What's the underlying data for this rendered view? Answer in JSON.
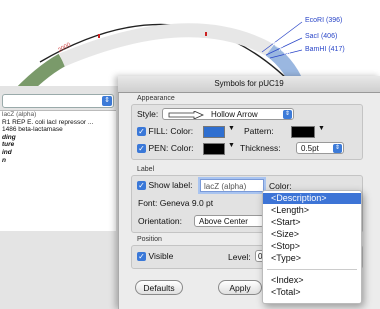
{
  "map": {
    "sites": [
      "EcoRI (396)",
      "SacI (406)",
      "BamHI (417)"
    ],
    "segment_labels": [
      "lacZ (alpha)",
      "2000"
    ]
  },
  "left": {
    "select_value": "",
    "features": [
      "lacZ (alpha)",
      "R1 REP E. coli lacI repressor ...",
      "1486 beta-lactamase",
      "ding",
      "ture",
      "ind",
      "n"
    ]
  },
  "dialog": {
    "title": "Symbols for pUC19",
    "appearance_label": "Appearance",
    "style_label": "Style:",
    "style_value": "Hollow Arrow",
    "fill_label": "FILL:",
    "fill_color_label": "Color:",
    "fill_color": "#2f6fd0",
    "pattern_label": "Pattern:",
    "pen_label": "PEN:",
    "pen_color_label": "Color:",
    "pen_color": "#000000",
    "thickness_label": "Thickness:",
    "thickness_value": "0.5pt",
    "label_group": "Label",
    "show_label": "Show label:",
    "label_value": "lacZ (alpha)",
    "color_label": "Color:",
    "font_text": "Font: Geneva 9.0 pt",
    "orientation_label": "Orientation:",
    "orientation_value": "Above Center",
    "position_group": "Position",
    "visible_label": "Visible",
    "level_label": "Level:",
    "level_value": "0",
    "defaults_button": "Defaults",
    "apply_button": "Apply"
  },
  "menu": {
    "items_top": [
      "<Description>",
      "<Length>",
      "<Start>",
      "<Size>",
      "<Stop>",
      "<Type>"
    ],
    "items_bottom": [
      "<Index>",
      "<Total>"
    ],
    "highlighted": "<Description>"
  }
}
